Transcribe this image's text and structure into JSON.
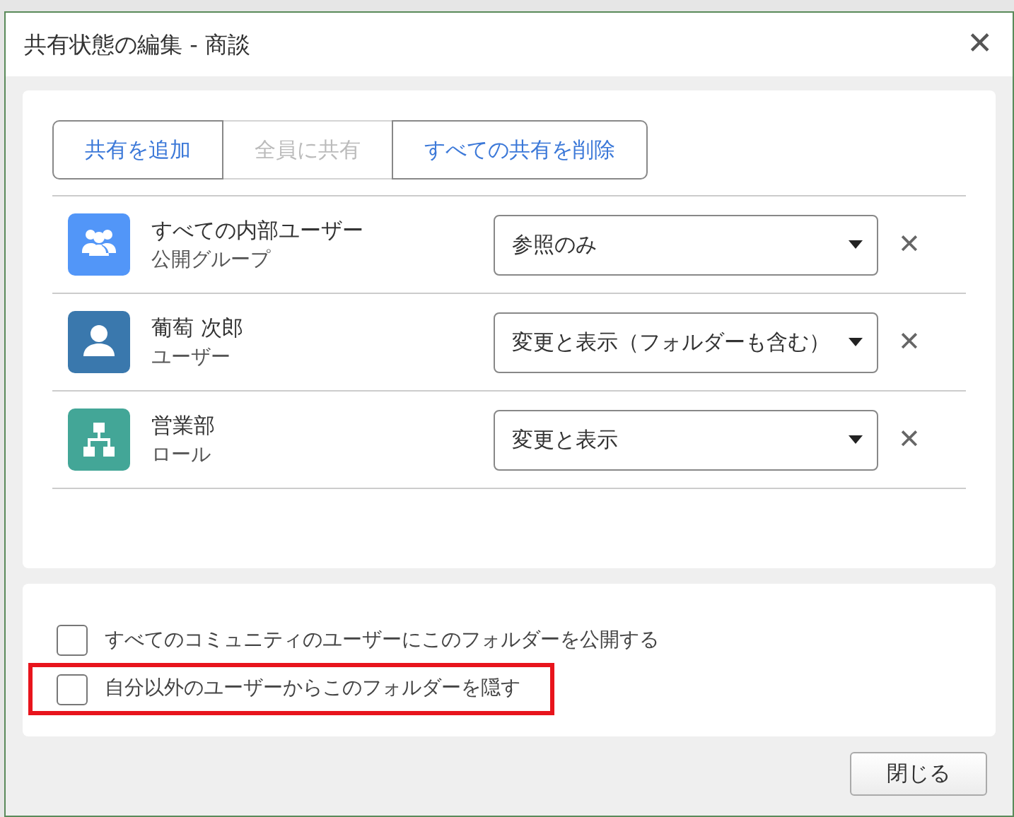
{
  "window": {
    "title": "共有状態の編集 - 商談",
    "close": "✕"
  },
  "actions": [
    {
      "label": "共有を追加",
      "disabled": false
    },
    {
      "label": "全員に共有",
      "disabled": true
    },
    {
      "label": "すべての共有を削除",
      "disabled": false
    }
  ],
  "shares": [
    {
      "kind": "group",
      "color": "#5296f8",
      "name": "すべての内部ユーザー",
      "type": "公開グループ",
      "access": "参照のみ",
      "remove": "✕"
    },
    {
      "kind": "user",
      "color": "#3a78ad",
      "name": "葡萄 次郎",
      "type": "ユーザー",
      "access": "変更と表示（フォルダーも含む）",
      "remove": "✕"
    },
    {
      "kind": "role",
      "color": "#43a697",
      "name": "営業部",
      "type": "ロール",
      "access": "変更と表示",
      "remove": "✕"
    }
  ],
  "options": [
    {
      "label": "すべてのコミュニティのユーザーにこのフォルダーを公開する",
      "checked": false,
      "highlighted": false
    },
    {
      "label": "自分以外のユーザーからこのフォルダーを隠す",
      "checked": false,
      "highlighted": true
    }
  ],
  "footer": {
    "close": "閉じる"
  }
}
